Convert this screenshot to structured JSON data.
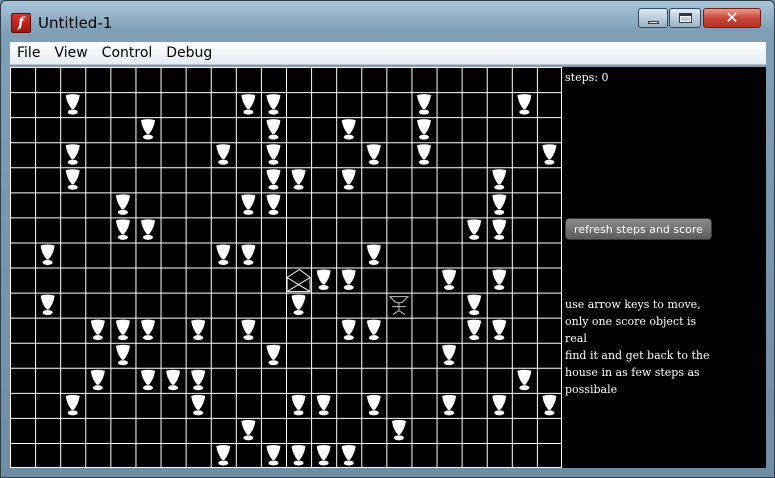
{
  "window": {
    "title": "Untitled-1"
  },
  "menu": {
    "items": [
      "File",
      "View",
      "Control",
      "Debug"
    ]
  },
  "panel": {
    "steps_label": "steps: 0",
    "refresh_label": "refresh steps and score",
    "instructions": [
      "use arrow keys to move,",
      "only one score object is real",
      "find it and get back to the",
      "house in as few steps as",
      "possibale"
    ]
  },
  "board": {
    "cols": 22,
    "rows": 16,
    "colors": {
      "background": "#000000",
      "grid": "#ffffff",
      "objects": "#ffffff"
    },
    "house": {
      "col": 11,
      "row": 8
    },
    "player": {
      "col": 15,
      "row": 9
    },
    "score_objects": [
      [
        2,
        1
      ],
      [
        9,
        1
      ],
      [
        10,
        1
      ],
      [
        16,
        1
      ],
      [
        20,
        1
      ],
      [
        5,
        2
      ],
      [
        10,
        2
      ],
      [
        13,
        2
      ],
      [
        16,
        2
      ],
      [
        2,
        3
      ],
      [
        8,
        3
      ],
      [
        10,
        3
      ],
      [
        14,
        3
      ],
      [
        16,
        3
      ],
      [
        21,
        3
      ],
      [
        2,
        4
      ],
      [
        10,
        4
      ],
      [
        11,
        4
      ],
      [
        13,
        4
      ],
      [
        19,
        4
      ],
      [
        4,
        5
      ],
      [
        9,
        5
      ],
      [
        10,
        5
      ],
      [
        19,
        5
      ],
      [
        4,
        6
      ],
      [
        5,
        6
      ],
      [
        18,
        6
      ],
      [
        19,
        6
      ],
      [
        1,
        7
      ],
      [
        8,
        7
      ],
      [
        9,
        7
      ],
      [
        14,
        7
      ],
      [
        12,
        8
      ],
      [
        13,
        8
      ],
      [
        17,
        8
      ],
      [
        19,
        8
      ],
      [
        1,
        9
      ],
      [
        11,
        9
      ],
      [
        18,
        9
      ],
      [
        3,
        10
      ],
      [
        4,
        10
      ],
      [
        5,
        10
      ],
      [
        7,
        10
      ],
      [
        9,
        10
      ],
      [
        13,
        10
      ],
      [
        14,
        10
      ],
      [
        18,
        10
      ],
      [
        19,
        10
      ],
      [
        4,
        11
      ],
      [
        10,
        11
      ],
      [
        17,
        11
      ],
      [
        3,
        12
      ],
      [
        5,
        12
      ],
      [
        6,
        12
      ],
      [
        7,
        12
      ],
      [
        20,
        12
      ],
      [
        2,
        13
      ],
      [
        7,
        13
      ],
      [
        11,
        13
      ],
      [
        12,
        13
      ],
      [
        14,
        13
      ],
      [
        17,
        13
      ],
      [
        19,
        13
      ],
      [
        21,
        13
      ],
      [
        9,
        14
      ],
      [
        15,
        14
      ],
      [
        8,
        15
      ],
      [
        10,
        15
      ],
      [
        11,
        15
      ],
      [
        12,
        15
      ],
      [
        13,
        15
      ]
    ]
  }
}
